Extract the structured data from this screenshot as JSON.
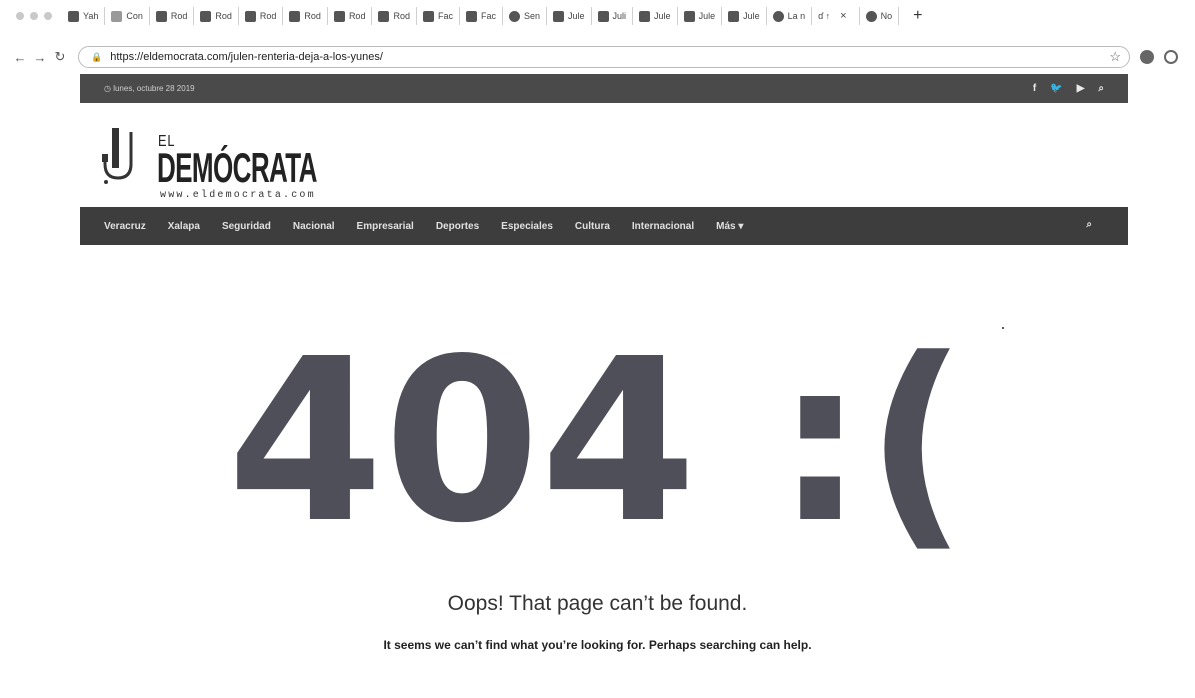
{
  "browser": {
    "tabs": [
      {
        "label": "Yah",
        "icon": "mail-icon"
      },
      {
        "label": "Con",
        "icon": "generic-icon"
      },
      {
        "label": "Rod",
        "icon": "facebook-icon"
      },
      {
        "label": "Rod",
        "icon": "facebook-icon"
      },
      {
        "label": "Rod",
        "icon": "facebook-icon"
      },
      {
        "label": "Rod",
        "icon": "facebook-icon"
      },
      {
        "label": "Rod",
        "icon": "facebook-icon"
      },
      {
        "label": "Rod",
        "icon": "facebook-icon"
      },
      {
        "label": "Fac",
        "icon": "facebook-icon"
      },
      {
        "label": "Fac",
        "icon": "facebook-icon"
      },
      {
        "label": "Sen",
        "icon": "globe-icon"
      },
      {
        "label": "Jule",
        "icon": "facebook-icon"
      },
      {
        "label": "Juli",
        "icon": "facebook-icon"
      },
      {
        "label": "Jule",
        "icon": "facebook-icon"
      },
      {
        "label": "Jule",
        "icon": "facebook-icon"
      },
      {
        "label": "Jule",
        "icon": "facebook-icon"
      },
      {
        "label": "La n",
        "icon": "dot-icon"
      },
      {
        "label": "No",
        "icon": "globe-icon"
      }
    ],
    "active_tab_glyphs": "ɗ ↑",
    "close_glyph": "×",
    "new_tab": "+",
    "url": "https://eldemocrata.com/julen-renteria-deja-a-los-yunes/"
  },
  "site": {
    "date": "lunes, octubre 28 2019",
    "social": [
      "f",
      "🐦",
      "▶",
      "⌕"
    ],
    "logo": {
      "el": "EL",
      "name": "DEMÓCRATA",
      "url": "www.eldemocrata.com"
    },
    "nav": [
      "Veracruz",
      "Xalapa",
      "Seguridad",
      "Nacional",
      "Empresarial",
      "Deportes",
      "Especiales",
      "Cultura",
      "Internacional",
      "Más ▾"
    ],
    "search_icon": "⌕"
  },
  "error": {
    "code": "404 :(",
    "title": "Oops! That page can’t be found.",
    "subtitle": "It seems we can’t find what you’re looking for. Perhaps searching can help."
  }
}
